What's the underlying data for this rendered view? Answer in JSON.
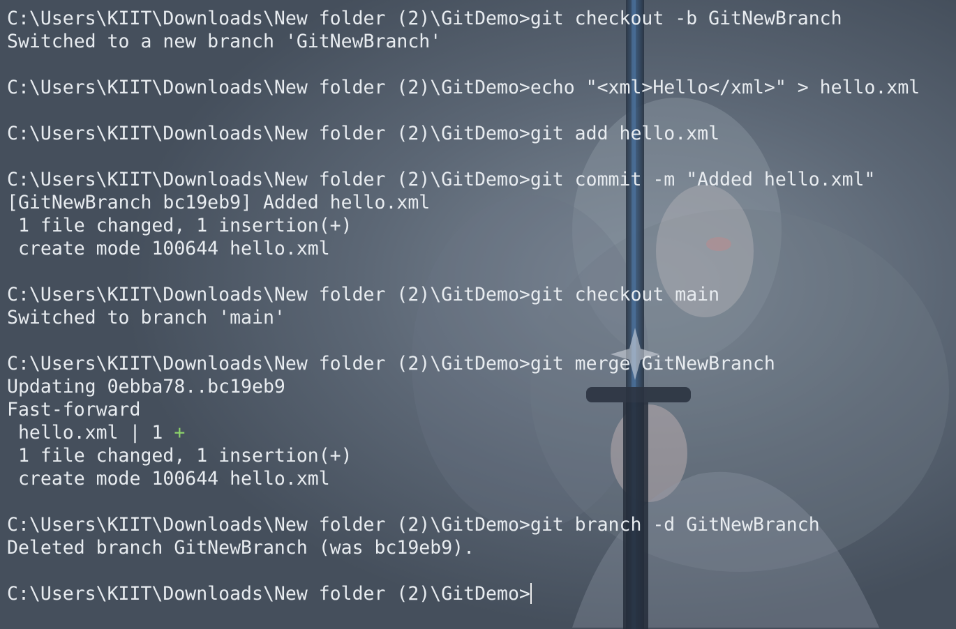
{
  "theme": {
    "text_color": "#e8ecf0",
    "background_color": "#4a5563",
    "diff_plus_color": "#8cd36a"
  },
  "terminal": {
    "lines": [
      {
        "prompt": "C:\\Users\\KIIT\\Downloads\\New folder (2)\\GitDemo>",
        "command": "git checkout -b GitNewBranch"
      },
      {
        "output": "Switched to a new branch 'GitNewBranch'"
      },
      {
        "output": ""
      },
      {
        "prompt": "C:\\Users\\KIIT\\Downloads\\New folder (2)\\GitDemo>",
        "command": "echo \"<xml>Hello</xml>\" > hello.xml"
      },
      {
        "output": ""
      },
      {
        "prompt": "C:\\Users\\KIIT\\Downloads\\New folder (2)\\GitDemo>",
        "command": "git add hello.xml"
      },
      {
        "output": ""
      },
      {
        "prompt": "C:\\Users\\KIIT\\Downloads\\New folder (2)\\GitDemo>",
        "command": "git commit -m \"Added hello.xml\""
      },
      {
        "output": "[GitNewBranch bc19eb9] Added hello.xml"
      },
      {
        "output": " 1 file changed, 1 insertion(+)"
      },
      {
        "output": " create mode 100644 hello.xml"
      },
      {
        "output": ""
      },
      {
        "prompt": "C:\\Users\\KIIT\\Downloads\\New folder (2)\\GitDemo>",
        "command": "git checkout main"
      },
      {
        "output": "Switched to branch 'main'"
      },
      {
        "output": ""
      },
      {
        "prompt": "C:\\Users\\KIIT\\Downloads\\New folder (2)\\GitDemo>",
        "command": "git merge GitNewBranch"
      },
      {
        "output": "Updating 0ebba78..bc19eb9"
      },
      {
        "output": "Fast-forward"
      },
      {
        "output": " hello.xml | 1 ",
        "suffix": "+"
      },
      {
        "output": " 1 file changed, 1 insertion(+)"
      },
      {
        "output": " create mode 100644 hello.xml"
      },
      {
        "output": ""
      },
      {
        "prompt": "C:\\Users\\KIIT\\Downloads\\New folder (2)\\GitDemo>",
        "command": "git branch -d GitNewBranch"
      },
      {
        "output": "Deleted branch GitNewBranch (was bc19eb9)."
      },
      {
        "output": ""
      },
      {
        "prompt": "C:\\Users\\KIIT\\Downloads\\New folder (2)\\GitDemo>",
        "command": "",
        "cursor": true
      }
    ]
  }
}
